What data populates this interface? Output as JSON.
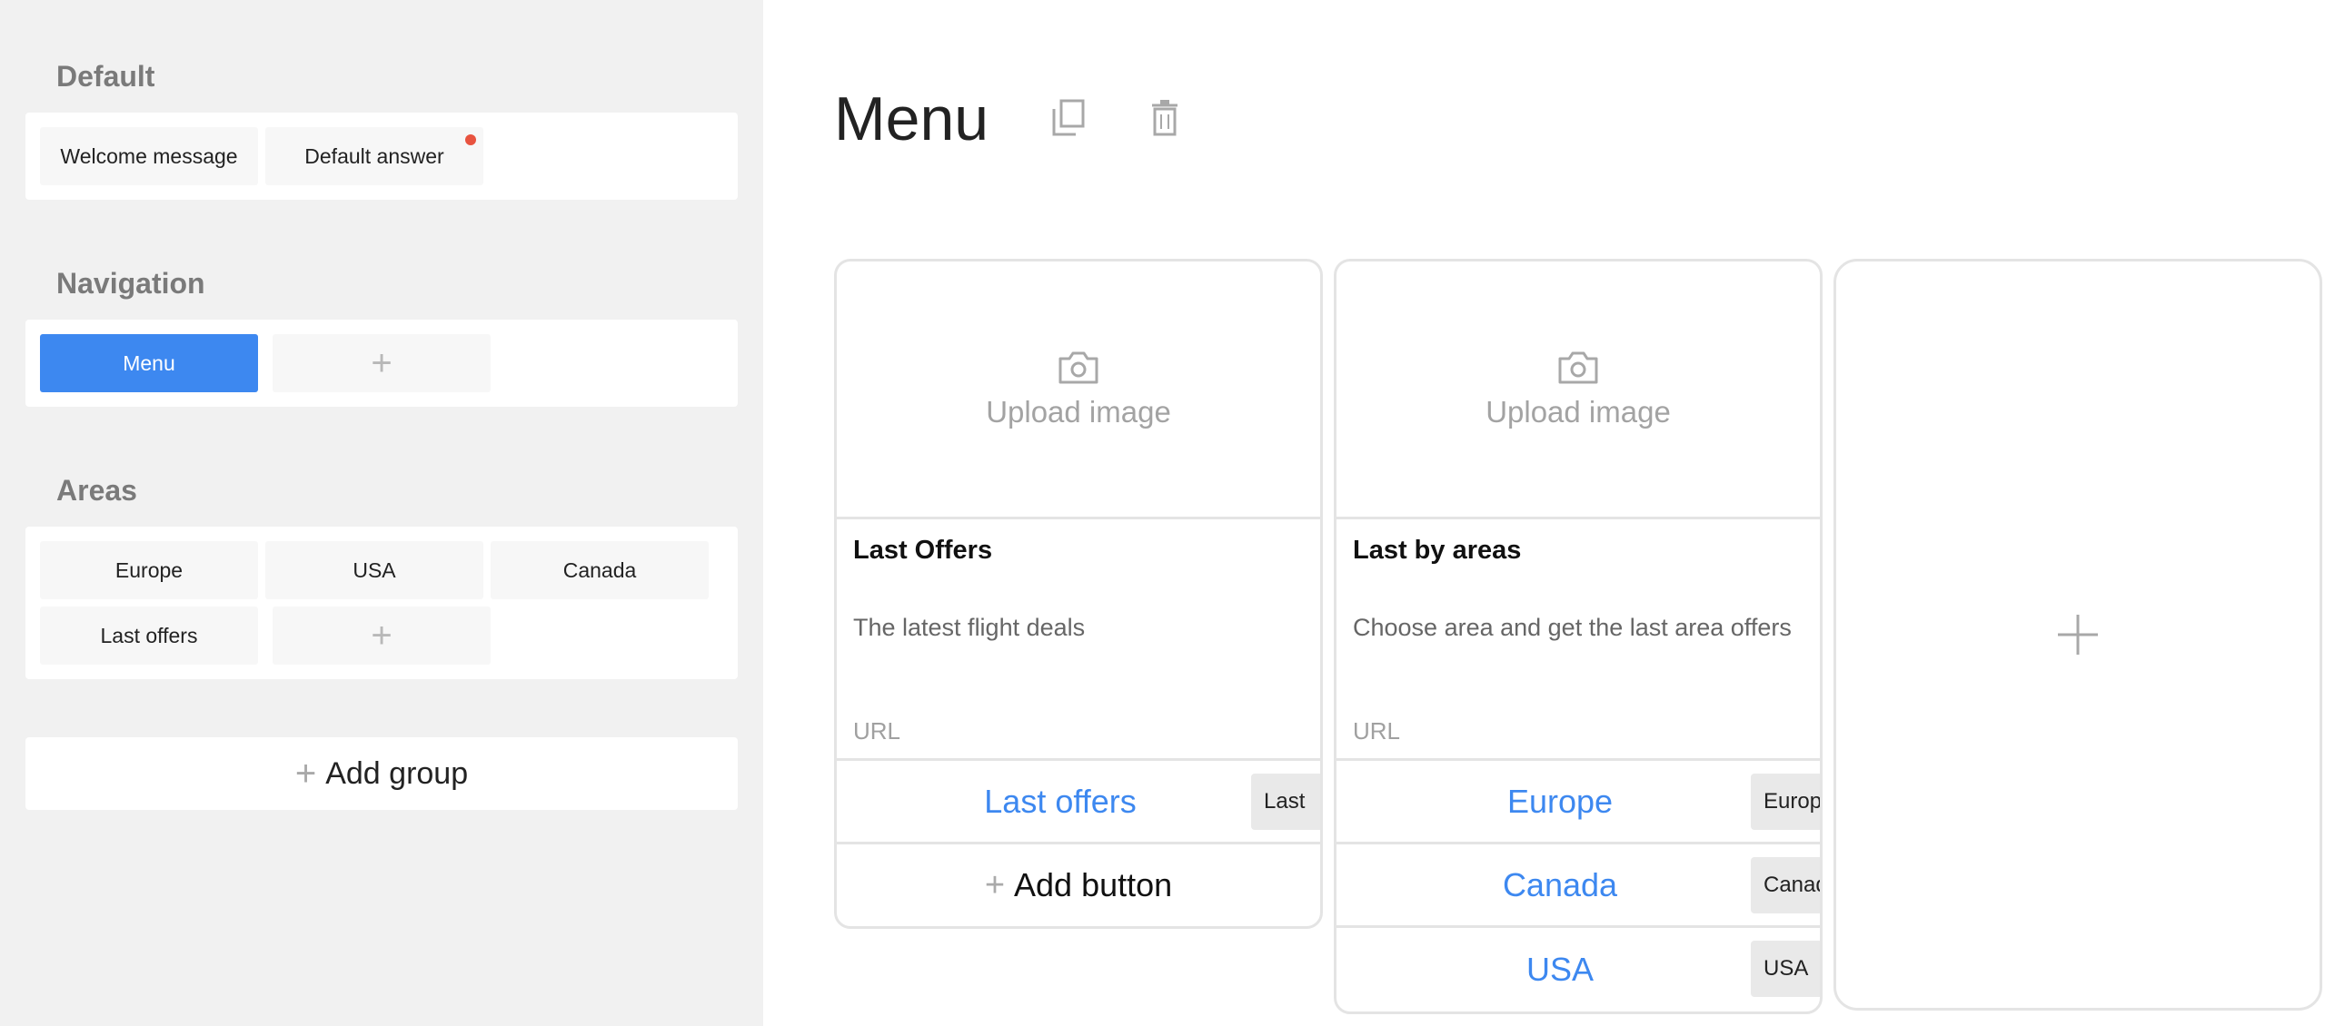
{
  "sidebar": {
    "groups": [
      {
        "title": "Default",
        "items": [
          "Welcome message",
          "Default answer"
        ]
      },
      {
        "title": "Navigation",
        "items": [
          "Menu"
        ]
      },
      {
        "title": "Areas",
        "items": [
          "Europe",
          "USA",
          "Canada",
          "Last offers"
        ]
      }
    ],
    "add_group_label": "Add group",
    "add_plus": "+"
  },
  "main": {
    "title": "Menu",
    "cards": [
      {
        "upload_label": "Upload image",
        "title": "Last Offers",
        "description": "The latest flight deals",
        "url_label": "URL",
        "buttons": [
          {
            "label": "Last offers",
            "tag": "Last"
          }
        ],
        "add_button_label": "Add button"
      },
      {
        "upload_label": "Upload image",
        "title": "Last by areas",
        "description": "Choose area and get the last area offers",
        "url_label": "URL",
        "buttons": [
          {
            "label": "Europe",
            "tag": "Europe"
          },
          {
            "label": "Canada",
            "tag": "Canada"
          },
          {
            "label": "USA",
            "tag": "USA"
          }
        ]
      }
    ]
  },
  "icons": {
    "copy": "copy-icon",
    "delete": "trash-icon",
    "camera": "camera-icon",
    "plus": "plus-icon",
    "notification_dot": "notification-dot"
  },
  "colors": {
    "accent": "#3d88f0",
    "sidebar_bg": "#f1f1f1",
    "dot": "#e8533f"
  }
}
